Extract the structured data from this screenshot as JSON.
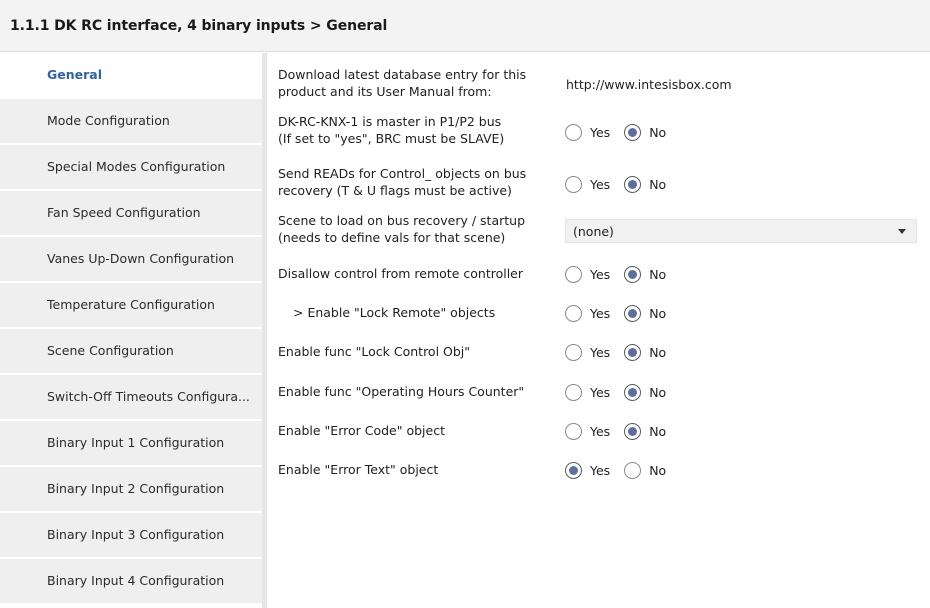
{
  "header": {
    "title": "1.1.1 DK RC interface, 4 binary inputs > General"
  },
  "sidebar": {
    "items": [
      {
        "label": "General",
        "active": true
      },
      {
        "label": "Mode Configuration"
      },
      {
        "label": "Special Modes Configuration"
      },
      {
        "label": "Fan Speed Configuration"
      },
      {
        "label": "Vanes Up-Down Configuration"
      },
      {
        "label": "Temperature Configuration"
      },
      {
        "label": "Scene Configuration"
      },
      {
        "label": "Switch-Off Timeouts Configura..."
      },
      {
        "label": "Binary Input 1 Configuration"
      },
      {
        "label": "Binary Input 2 Configuration"
      },
      {
        "label": "Binary Input 3 Configuration"
      },
      {
        "label": "Binary Input 4 Configuration"
      }
    ]
  },
  "params": {
    "download": {
      "line1": "Download latest database entry for this",
      "line2": "product and its User Manual from:",
      "value": "http://www.intesisbox.com"
    },
    "master": {
      "line1": "DK-RC-KNX-1 is master in P1/P2 bus",
      "line2": "(If set to \"yes\", BRC must be SLAVE)",
      "selected": "No"
    },
    "send_reads": {
      "line1": "Send READs for Control_ objects on bus",
      "line2": "recovery (T & U flags must be active)",
      "selected": "No"
    },
    "scene": {
      "line1": "Scene to load on bus recovery / startup",
      "line2": "(needs to define vals for that scene)",
      "value": "(none)"
    },
    "disallow": {
      "label": "Disallow control from remote controller",
      "selected": "No"
    },
    "lock_remote": {
      "label": "> Enable \"Lock Remote\" objects",
      "selected": "No"
    },
    "lock_control": {
      "label": "Enable func \"Lock Control Obj\"",
      "selected": "No"
    },
    "op_hours": {
      "label": "Enable func \"Operating Hours Counter\"",
      "selected": "No"
    },
    "error_code": {
      "label": "Enable \"Error Code\" object",
      "selected": "No"
    },
    "error_text": {
      "label": "Enable \"Error Text\" object",
      "selected": "Yes"
    }
  },
  "radio_labels": {
    "yes": "Yes",
    "no": "No"
  }
}
